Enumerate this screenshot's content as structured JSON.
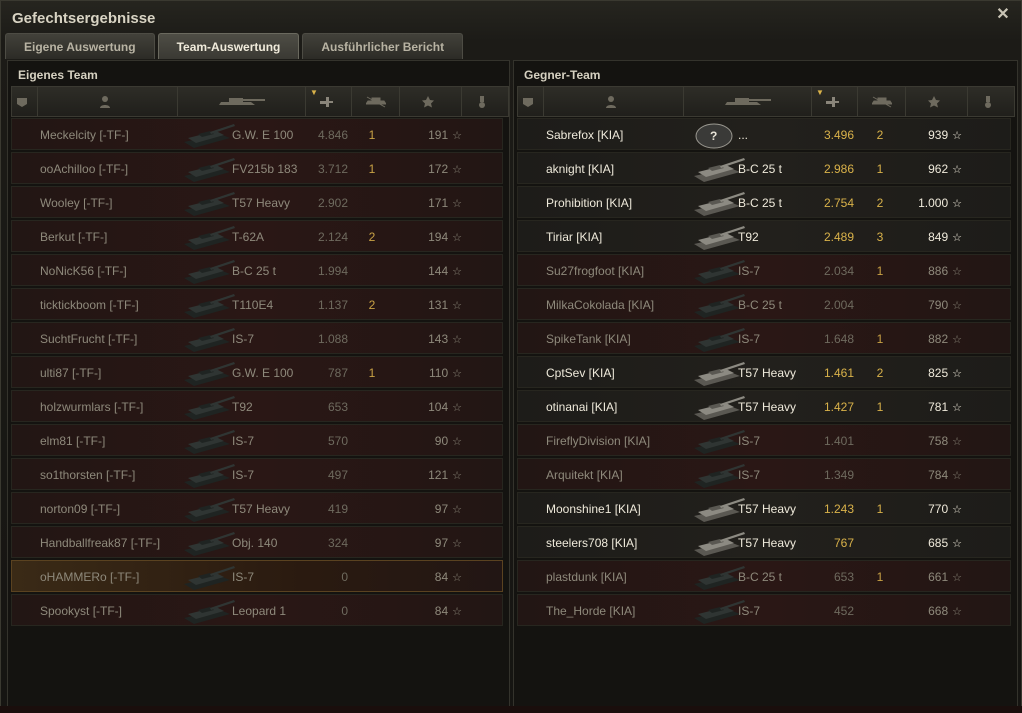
{
  "window": {
    "title": "Gefechtsergebnisse"
  },
  "tabs": [
    {
      "label": "Eigene Auswertung",
      "active": false
    },
    {
      "label": "Team-Auswertung",
      "active": true
    },
    {
      "label": "Ausführlicher Bericht",
      "active": false
    }
  ],
  "own_team": {
    "title": "Eigenes Team",
    "rows": [
      {
        "name": "Meckelcity [-TF-]",
        "tank": "G.W. E 100",
        "points": "4.846",
        "kills": "1",
        "xp": "191",
        "state": "dead"
      },
      {
        "name": "ooAchilloo [-TF-]",
        "tank": "FV215b 183",
        "points": "3.712",
        "kills": "1",
        "xp": "172",
        "state": "dead"
      },
      {
        "name": "Wooley [-TF-]",
        "tank": "T57 Heavy",
        "points": "2.902",
        "kills": "",
        "xp": "171",
        "state": "dead"
      },
      {
        "name": "Berkut [-TF-]",
        "tank": "T-62A",
        "points": "2.124",
        "kills": "2",
        "xp": "194",
        "state": "dead"
      },
      {
        "name": "NoNicK56 [-TF-]",
        "tank": "B-C 25 t",
        "points": "1.994",
        "kills": "",
        "xp": "144",
        "state": "dead"
      },
      {
        "name": "ticktickboom [-TF-]",
        "tank": "T110E4",
        "points": "1.137",
        "kills": "2",
        "xp": "131",
        "state": "dead"
      },
      {
        "name": "SuchtFrucht [-TF-]",
        "tank": "IS-7",
        "points": "1.088",
        "kills": "",
        "xp": "143",
        "state": "dead"
      },
      {
        "name": "ulti87 [-TF-]",
        "tank": "G.W. E 100",
        "points": "787",
        "kills": "1",
        "xp": "110",
        "state": "dead"
      },
      {
        "name": "holzwurmlars [-TF-]",
        "tank": "T92",
        "points": "653",
        "kills": "",
        "xp": "104",
        "state": "dead"
      },
      {
        "name": "elm81 [-TF-]",
        "tank": "IS-7",
        "points": "570",
        "kills": "",
        "xp": "90",
        "state": "dead"
      },
      {
        "name": "so1thorsten [-TF-]",
        "tank": "IS-7",
        "points": "497",
        "kills": "",
        "xp": "121",
        "state": "dead"
      },
      {
        "name": "norton09 [-TF-]",
        "tank": "T57 Heavy",
        "points": "419",
        "kills": "",
        "xp": "97",
        "state": "dead"
      },
      {
        "name": "Handballfreak87 [-TF-]",
        "tank": "Obj. 140",
        "points": "324",
        "kills": "",
        "xp": "97",
        "state": "dead"
      },
      {
        "name": "oHAMMERo [-TF-]",
        "tank": "IS-7",
        "points": "0",
        "kills": "",
        "xp": "84",
        "state": "me"
      },
      {
        "name": "Spookyst [-TF-]",
        "tank": "Leopard 1",
        "points": "0",
        "kills": "",
        "xp": "84",
        "state": "dead"
      }
    ]
  },
  "enemy_team": {
    "title": "Gegner-Team",
    "rows": [
      {
        "name": "Sabrefox [KIA]",
        "tank": "...",
        "points": "3.496",
        "kills": "2",
        "xp": "939",
        "state": "alive",
        "unknown": true
      },
      {
        "name": "aknight [KIA]",
        "tank": "B-C 25 t",
        "points": "2.986",
        "kills": "1",
        "xp": "962",
        "state": "alive"
      },
      {
        "name": "Prohibition [KIA]",
        "tank": "B-C 25 t",
        "points": "2.754",
        "kills": "2",
        "xp": "1.000",
        "state": "alive"
      },
      {
        "name": "Tiriar [KIA]",
        "tank": "T92",
        "points": "2.489",
        "kills": "3",
        "xp": "849",
        "state": "alive"
      },
      {
        "name": "Su27frogfoot [KIA]",
        "tank": "IS-7",
        "points": "2.034",
        "kills": "1",
        "xp": "886",
        "state": "dead"
      },
      {
        "name": "MilkaCokolada [KIA]",
        "tank": "B-C 25 t",
        "points": "2.004",
        "kills": "",
        "xp": "790",
        "state": "dead"
      },
      {
        "name": "SpikeTank [KIA]",
        "tank": "IS-7",
        "points": "1.648",
        "kills": "1",
        "xp": "882",
        "state": "dead"
      },
      {
        "name": "CptSev [KIA]",
        "tank": "T57 Heavy",
        "points": "1.461",
        "kills": "2",
        "xp": "825",
        "state": "alive"
      },
      {
        "name": "otinanai [KIA]",
        "tank": "T57 Heavy",
        "points": "1.427",
        "kills": "1",
        "xp": "781",
        "state": "alive"
      },
      {
        "name": "FireflyDivision [KIA]",
        "tank": "IS-7",
        "points": "1.401",
        "kills": "",
        "xp": "758",
        "state": "dead"
      },
      {
        "name": "Arquitekt [KIA]",
        "tank": "IS-7",
        "points": "1.349",
        "kills": "",
        "xp": "784",
        "state": "dead"
      },
      {
        "name": "Moonshine1 [KIA]",
        "tank": "T57 Heavy",
        "points": "1.243",
        "kills": "1",
        "xp": "770",
        "state": "alive"
      },
      {
        "name": "steelers708 [KIA]",
        "tank": "T57 Heavy",
        "points": "767",
        "kills": "",
        "xp": "685",
        "state": "alive"
      },
      {
        "name": "plastdunk [KIA]",
        "tank": "B-C 25 t",
        "points": "653",
        "kills": "1",
        "xp": "661",
        "state": "dead"
      },
      {
        "name": "The_Horde [KIA]",
        "tank": "IS-7",
        "points": "452",
        "kills": "",
        "xp": "668",
        "state": "dead"
      }
    ]
  },
  "colors": {
    "gold": "#d9b24a",
    "alive_text": "#efeadb",
    "dead_text": "#8e897b"
  },
  "icons": {
    "star": "☆",
    "close": "✕"
  }
}
